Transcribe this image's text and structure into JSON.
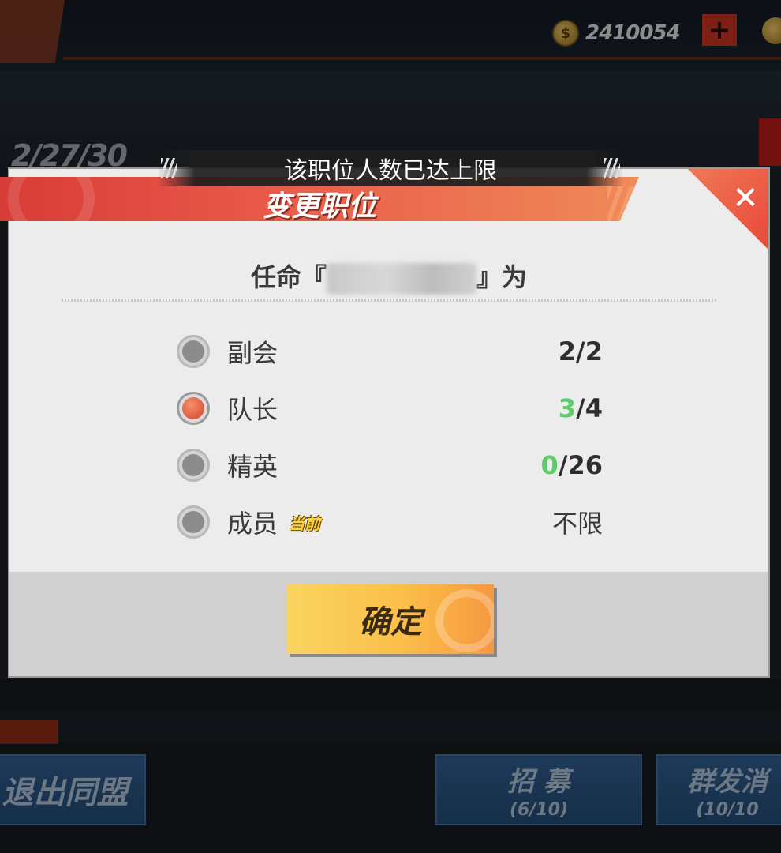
{
  "topbar": {
    "coin_icon_glyph": "$",
    "coin_value": "2410054",
    "plus_glyph": "+"
  },
  "background": {
    "date": "2/27/30",
    "leave_button": "退出同盟",
    "recruit_button": "招 募",
    "recruit_count": "(6/10)",
    "mass_button": "群发消",
    "mass_count": "(10/10"
  },
  "toast": {
    "message": "该职位人数已达上限"
  },
  "dialog": {
    "title": "变更职位",
    "close_glyph": "✕",
    "appoint_prefix": "任命『",
    "appoint_suffix": "』为",
    "roles": [
      {
        "name": "副会",
        "count_highlight": "",
        "count_rest": "2/2",
        "selected": false,
        "badge": ""
      },
      {
        "name": "队长",
        "count_highlight": "3",
        "count_rest": "/4",
        "selected": true,
        "badge": ""
      },
      {
        "name": "精英",
        "count_highlight": "0",
        "count_rest": "/26",
        "selected": false,
        "badge": ""
      },
      {
        "name": "成员",
        "count_highlight": "",
        "count_rest": "不限",
        "selected": false,
        "badge": "当前"
      }
    ],
    "confirm_label": "确定"
  },
  "colors": {
    "header_red": "#d83c36",
    "confirm_yellow": "#fad460",
    "count_green": "#5ecb6a",
    "radio_selected": "#e8583a"
  }
}
